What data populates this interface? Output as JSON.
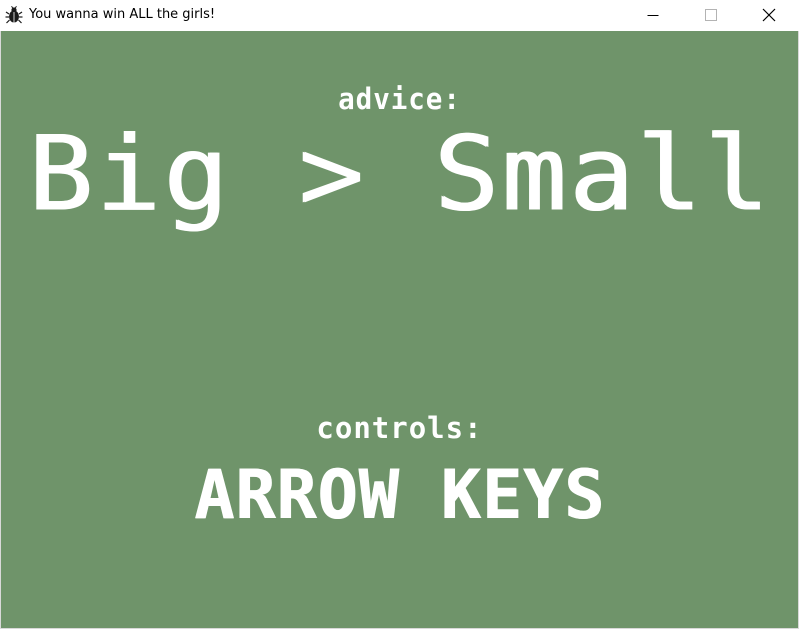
{
  "window": {
    "title": "You wanna win ALL the girls!",
    "icon": "bug-icon",
    "buttons": {
      "minimize": "minimize-icon",
      "maximize": "maximize-icon",
      "close": "close-icon"
    }
  },
  "game": {
    "background_color": "#6f946a",
    "text_color": "#ffffff",
    "advice_label": "advice:",
    "advice_text": "Big > Small",
    "controls_label": "controls:",
    "controls_text": "ARROW KEYS"
  }
}
